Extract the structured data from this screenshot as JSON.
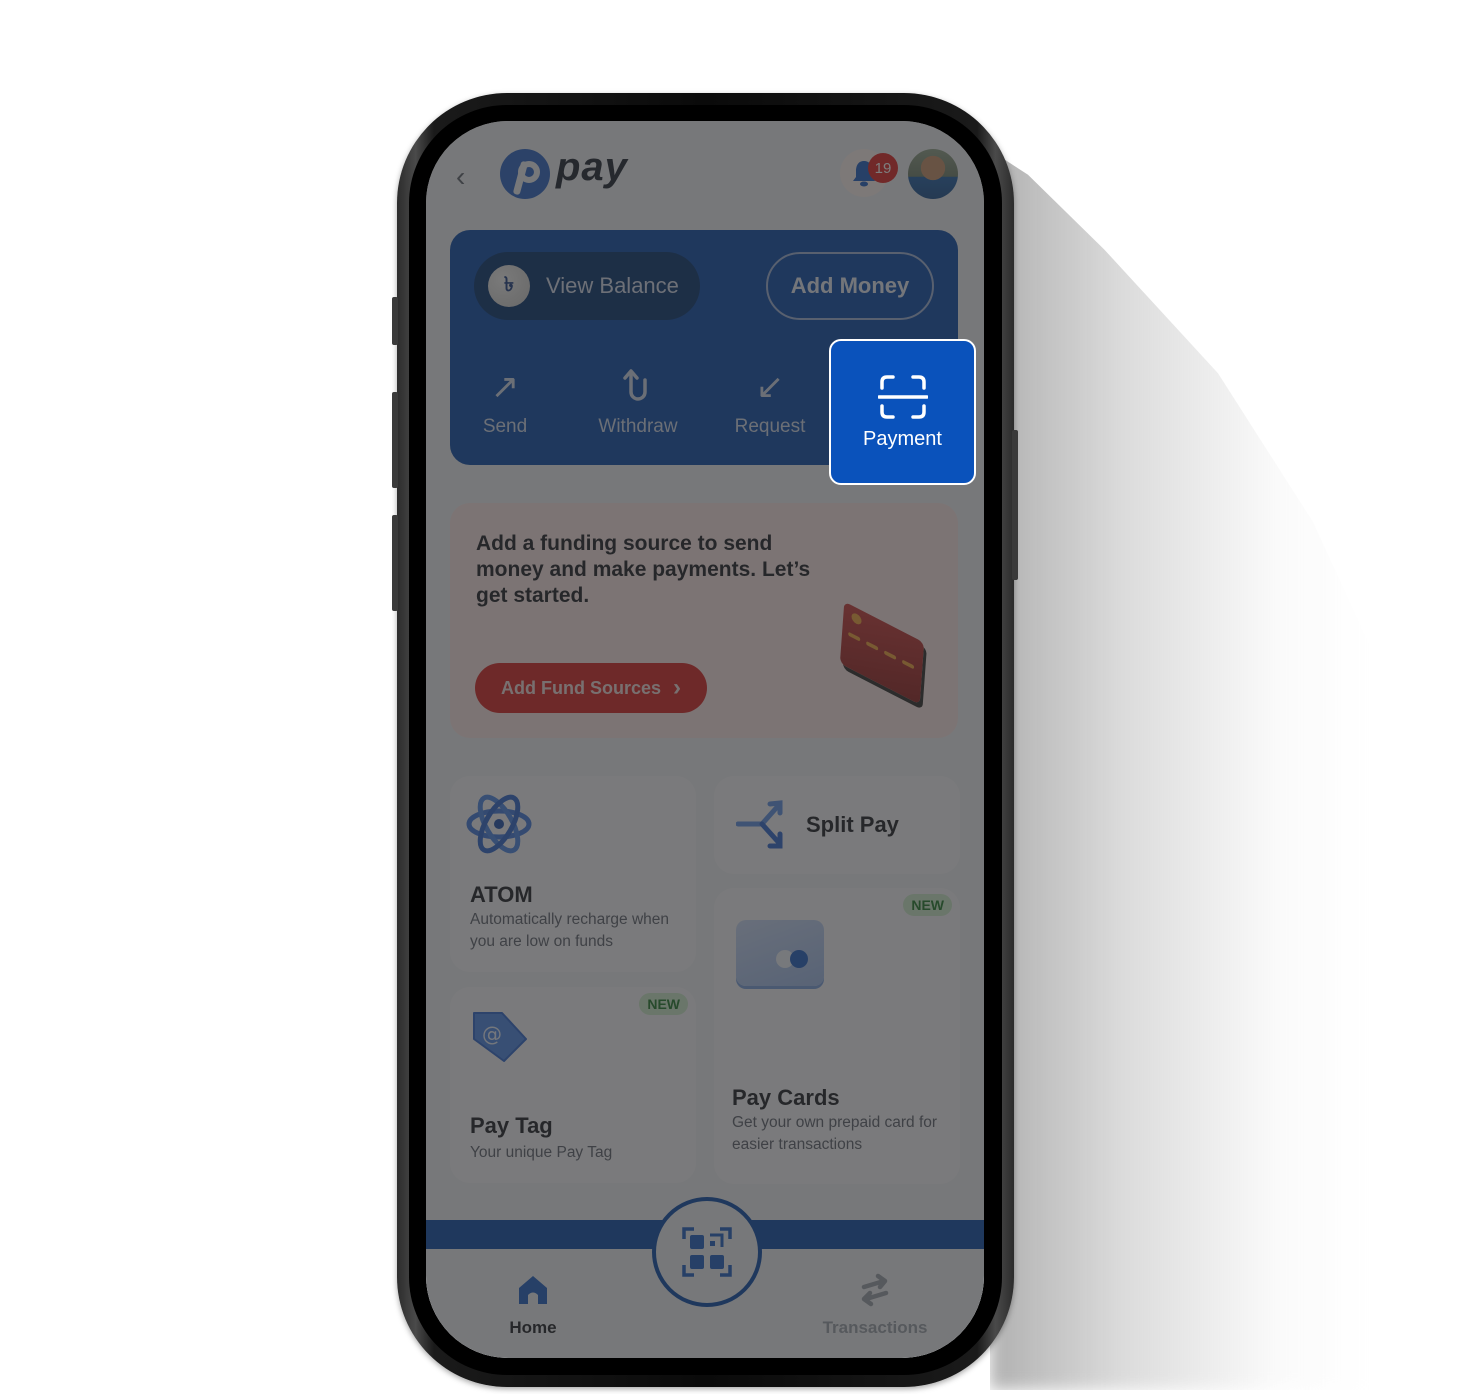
{
  "header": {
    "back_icon": "chevron-left-icon",
    "back_glyph": "‹",
    "logo_text": "pay",
    "notification_count": "19"
  },
  "balance_card": {
    "view_balance_label": "View Balance",
    "currency_glyph": "৳",
    "add_money_label": "Add Money",
    "actions": [
      {
        "label": "Send",
        "icon": "arrow-up-right-icon",
        "glyph": "↗"
      },
      {
        "label": "Withdraw",
        "icon": "u-turn-up-icon",
        "glyph": "⮍"
      },
      {
        "label": "Request",
        "icon": "arrow-down-left-icon",
        "glyph": "↙"
      },
      {
        "label": "Payment",
        "icon": "scan-icon"
      }
    ]
  },
  "fund_banner": {
    "message": "Add a funding source to send money and make payments. Let’s get started.",
    "button_label": "Add Fund Sources",
    "button_chevron": "›"
  },
  "tiles": {
    "atom": {
      "title": "ATOM",
      "subtitle": "Automatically recharge when you are low on funds"
    },
    "split_pay": {
      "title": "Split Pay"
    },
    "pay_cards": {
      "title": "Pay Cards",
      "subtitle": "Get your own prepaid card for easier transactions",
      "badge": "NEW"
    },
    "pay_tag": {
      "title": "Pay Tag",
      "subtitle": "Your unique Pay Tag",
      "badge": "NEW"
    }
  },
  "bottom_nav": {
    "home_label": "Home",
    "transactions_label": "Transactions"
  },
  "colors": {
    "brand_blue": "#0a4aaa",
    "highlight_blue": "#0a52bb",
    "alert_red": "#e02424",
    "new_badge_green": "#1f7a2a"
  }
}
